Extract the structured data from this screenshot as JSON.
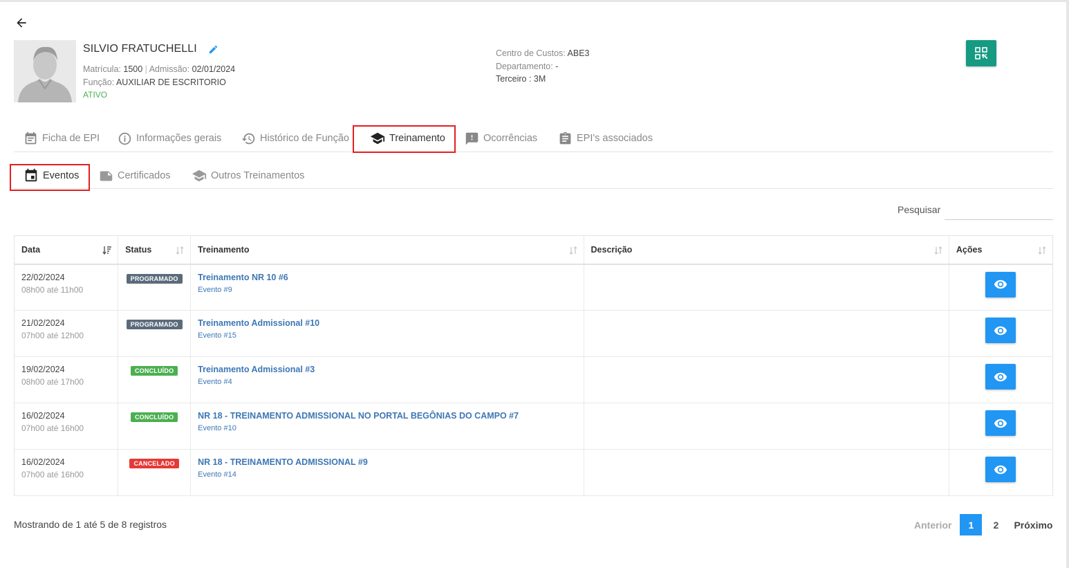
{
  "employee": {
    "name": "SILVIO FRATUCHELLI",
    "matricula_label": "Matrícula:",
    "matricula": "1500",
    "admissao_label": "Admissão:",
    "admissao": "02/01/2024",
    "funcao_label": "Função:",
    "funcao": "AUXILIAR DE ESCRITORIO",
    "status": "ATIVO",
    "centro_label": "Centro de Custos:",
    "centro": "ABE3",
    "departamento_label": "Departamento:",
    "departamento": "-",
    "terceiro_label": "Terceiro :",
    "terceiro": "3M"
  },
  "tabs": [
    {
      "label": "Ficha de EPI",
      "icon": "clipboard-list-icon"
    },
    {
      "label": "Informações gerais",
      "icon": "info-circle-icon"
    },
    {
      "label": "Histórico de Função",
      "icon": "history-icon"
    },
    {
      "label": "Treinamento",
      "icon": "graduation-cap-icon",
      "active": true
    },
    {
      "label": "Ocorrências",
      "icon": "feedback-alert-icon"
    },
    {
      "label": "EPI's associados",
      "icon": "clipboard-icon"
    }
  ],
  "subtabs": [
    {
      "label": "Eventos",
      "icon": "calendar-icon",
      "active": true
    },
    {
      "label": "Certificados",
      "icon": "note-icon"
    },
    {
      "label": "Outros Treinamentos",
      "icon": "graduation-cap-icon"
    }
  ],
  "search": {
    "label": "Pesquisar",
    "value": ""
  },
  "table": {
    "columns": [
      "Data",
      "Status",
      "Treinamento",
      "Descrição",
      "Ações"
    ],
    "rows": [
      {
        "date": "22/02/2024",
        "time": "08h00 até 11h00",
        "status": "PROGRAMADO",
        "status_color": "#5a6b7b",
        "training": "Treinamento NR 10 #6",
        "event": "Evento #9",
        "description": ""
      },
      {
        "date": "21/02/2024",
        "time": "07h00 até 12h00",
        "status": "PROGRAMADO",
        "status_color": "#5a6b7b",
        "training": "Treinamento Admissional #10",
        "event": "Evento #15",
        "description": ""
      },
      {
        "date": "19/02/2024",
        "time": "08h00 até 17h00",
        "status": "CONCLUÍDO",
        "status_color": "#4caf50",
        "training": "Treinamento Admissional #3",
        "event": "Evento #4",
        "description": ""
      },
      {
        "date": "16/02/2024",
        "time": "07h00 até 16h00",
        "status": "CONCLUÍDO",
        "status_color": "#4caf50",
        "training": "NR 18 - TREINAMENTO ADMISSIONAL NO PORTAL BEGÔNIAS DO CAMPO #7",
        "event": "Evento #10",
        "description": ""
      },
      {
        "date": "16/02/2024",
        "time": "07h00 até 16h00",
        "status": "CANCELADO",
        "status_color": "#e53935",
        "training": "NR 18 - TREINAMENTO ADMISSIONAL #9",
        "event": "Evento #14",
        "description": ""
      }
    ]
  },
  "footer": {
    "info": "Mostrando de 1 até 5 de 8 registros",
    "prev": "Anterior",
    "pages": [
      "1",
      "2"
    ],
    "next": "Próximo"
  },
  "colors": {
    "primary": "#2196f3",
    "qr_button": "#169a82",
    "link": "#3d77b4",
    "highlight_box": "#e41e1e"
  }
}
